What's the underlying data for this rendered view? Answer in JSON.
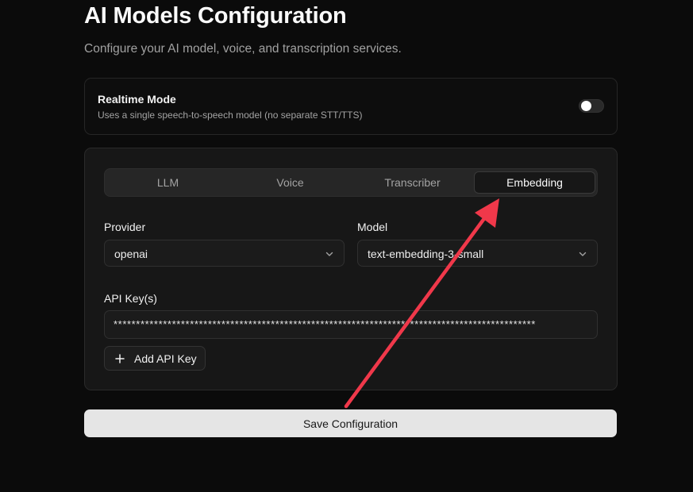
{
  "header": {
    "title": "AI Models Configuration",
    "subtitle": "Configure your AI model, voice, and transcription services."
  },
  "realtime": {
    "label": "Realtime Mode",
    "description": "Uses a single speech-to-speech model (no separate STT/TTS)",
    "enabled": false
  },
  "tabs": [
    {
      "label": "LLM",
      "active": false
    },
    {
      "label": "Voice",
      "active": false
    },
    {
      "label": "Transcriber",
      "active": false
    },
    {
      "label": "Embedding",
      "active": true
    }
  ],
  "form": {
    "provider_label": "Provider",
    "provider_value": "openai",
    "model_label": "Model",
    "model_value": "text-embedding-3-small",
    "api_key_label": "API Key(s)",
    "api_key_value": "**********************************************************************************************",
    "add_key_label": "Add API Key"
  },
  "actions": {
    "save_label": "Save Configuration"
  },
  "colors": {
    "background": "#0b0b0b",
    "annotation_arrow": "#f0384a"
  },
  "icons": [
    "chevron-down-icon",
    "plus-icon"
  ]
}
